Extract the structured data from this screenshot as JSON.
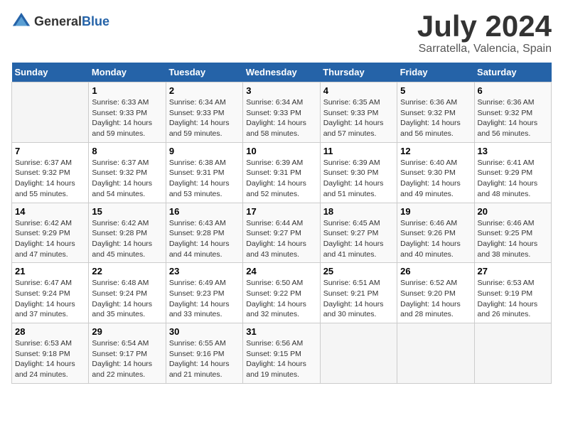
{
  "logo": {
    "general": "General",
    "blue": "Blue"
  },
  "title": "July 2024",
  "subtitle": "Sarratella, Valencia, Spain",
  "days_header": [
    "Sunday",
    "Monday",
    "Tuesday",
    "Wednesday",
    "Thursday",
    "Friday",
    "Saturday"
  ],
  "weeks": [
    [
      {
        "day": "",
        "sunrise": "",
        "sunset": "",
        "daylight": ""
      },
      {
        "day": "1",
        "sunrise": "Sunrise: 6:33 AM",
        "sunset": "Sunset: 9:33 PM",
        "daylight": "Daylight: 14 hours and 59 minutes."
      },
      {
        "day": "2",
        "sunrise": "Sunrise: 6:34 AM",
        "sunset": "Sunset: 9:33 PM",
        "daylight": "Daylight: 14 hours and 59 minutes."
      },
      {
        "day": "3",
        "sunrise": "Sunrise: 6:34 AM",
        "sunset": "Sunset: 9:33 PM",
        "daylight": "Daylight: 14 hours and 58 minutes."
      },
      {
        "day": "4",
        "sunrise": "Sunrise: 6:35 AM",
        "sunset": "Sunset: 9:33 PM",
        "daylight": "Daylight: 14 hours and 57 minutes."
      },
      {
        "day": "5",
        "sunrise": "Sunrise: 6:36 AM",
        "sunset": "Sunset: 9:32 PM",
        "daylight": "Daylight: 14 hours and 56 minutes."
      },
      {
        "day": "6",
        "sunrise": "Sunrise: 6:36 AM",
        "sunset": "Sunset: 9:32 PM",
        "daylight": "Daylight: 14 hours and 56 minutes."
      }
    ],
    [
      {
        "day": "7",
        "sunrise": "Sunrise: 6:37 AM",
        "sunset": "Sunset: 9:32 PM",
        "daylight": "Daylight: 14 hours and 55 minutes."
      },
      {
        "day": "8",
        "sunrise": "Sunrise: 6:37 AM",
        "sunset": "Sunset: 9:32 PM",
        "daylight": "Daylight: 14 hours and 54 minutes."
      },
      {
        "day": "9",
        "sunrise": "Sunrise: 6:38 AM",
        "sunset": "Sunset: 9:31 PM",
        "daylight": "Daylight: 14 hours and 53 minutes."
      },
      {
        "day": "10",
        "sunrise": "Sunrise: 6:39 AM",
        "sunset": "Sunset: 9:31 PM",
        "daylight": "Daylight: 14 hours and 52 minutes."
      },
      {
        "day": "11",
        "sunrise": "Sunrise: 6:39 AM",
        "sunset": "Sunset: 9:30 PM",
        "daylight": "Daylight: 14 hours and 51 minutes."
      },
      {
        "day": "12",
        "sunrise": "Sunrise: 6:40 AM",
        "sunset": "Sunset: 9:30 PM",
        "daylight": "Daylight: 14 hours and 49 minutes."
      },
      {
        "day": "13",
        "sunrise": "Sunrise: 6:41 AM",
        "sunset": "Sunset: 9:29 PM",
        "daylight": "Daylight: 14 hours and 48 minutes."
      }
    ],
    [
      {
        "day": "14",
        "sunrise": "Sunrise: 6:42 AM",
        "sunset": "Sunset: 9:29 PM",
        "daylight": "Daylight: 14 hours and 47 minutes."
      },
      {
        "day": "15",
        "sunrise": "Sunrise: 6:42 AM",
        "sunset": "Sunset: 9:28 PM",
        "daylight": "Daylight: 14 hours and 45 minutes."
      },
      {
        "day": "16",
        "sunrise": "Sunrise: 6:43 AM",
        "sunset": "Sunset: 9:28 PM",
        "daylight": "Daylight: 14 hours and 44 minutes."
      },
      {
        "day": "17",
        "sunrise": "Sunrise: 6:44 AM",
        "sunset": "Sunset: 9:27 PM",
        "daylight": "Daylight: 14 hours and 43 minutes."
      },
      {
        "day": "18",
        "sunrise": "Sunrise: 6:45 AM",
        "sunset": "Sunset: 9:27 PM",
        "daylight": "Daylight: 14 hours and 41 minutes."
      },
      {
        "day": "19",
        "sunrise": "Sunrise: 6:46 AM",
        "sunset": "Sunset: 9:26 PM",
        "daylight": "Daylight: 14 hours and 40 minutes."
      },
      {
        "day": "20",
        "sunrise": "Sunrise: 6:46 AM",
        "sunset": "Sunset: 9:25 PM",
        "daylight": "Daylight: 14 hours and 38 minutes."
      }
    ],
    [
      {
        "day": "21",
        "sunrise": "Sunrise: 6:47 AM",
        "sunset": "Sunset: 9:24 PM",
        "daylight": "Daylight: 14 hours and 37 minutes."
      },
      {
        "day": "22",
        "sunrise": "Sunrise: 6:48 AM",
        "sunset": "Sunset: 9:24 PM",
        "daylight": "Daylight: 14 hours and 35 minutes."
      },
      {
        "day": "23",
        "sunrise": "Sunrise: 6:49 AM",
        "sunset": "Sunset: 9:23 PM",
        "daylight": "Daylight: 14 hours and 33 minutes."
      },
      {
        "day": "24",
        "sunrise": "Sunrise: 6:50 AM",
        "sunset": "Sunset: 9:22 PM",
        "daylight": "Daylight: 14 hours and 32 minutes."
      },
      {
        "day": "25",
        "sunrise": "Sunrise: 6:51 AM",
        "sunset": "Sunset: 9:21 PM",
        "daylight": "Daylight: 14 hours and 30 minutes."
      },
      {
        "day": "26",
        "sunrise": "Sunrise: 6:52 AM",
        "sunset": "Sunset: 9:20 PM",
        "daylight": "Daylight: 14 hours and 28 minutes."
      },
      {
        "day": "27",
        "sunrise": "Sunrise: 6:53 AM",
        "sunset": "Sunset: 9:19 PM",
        "daylight": "Daylight: 14 hours and 26 minutes."
      }
    ],
    [
      {
        "day": "28",
        "sunrise": "Sunrise: 6:53 AM",
        "sunset": "Sunset: 9:18 PM",
        "daylight": "Daylight: 14 hours and 24 minutes."
      },
      {
        "day": "29",
        "sunrise": "Sunrise: 6:54 AM",
        "sunset": "Sunset: 9:17 PM",
        "daylight": "Daylight: 14 hours and 22 minutes."
      },
      {
        "day": "30",
        "sunrise": "Sunrise: 6:55 AM",
        "sunset": "Sunset: 9:16 PM",
        "daylight": "Daylight: 14 hours and 21 minutes."
      },
      {
        "day": "31",
        "sunrise": "Sunrise: 6:56 AM",
        "sunset": "Sunset: 9:15 PM",
        "daylight": "Daylight: 14 hours and 19 minutes."
      },
      {
        "day": "",
        "sunrise": "",
        "sunset": "",
        "daylight": ""
      },
      {
        "day": "",
        "sunrise": "",
        "sunset": "",
        "daylight": ""
      },
      {
        "day": "",
        "sunrise": "",
        "sunset": "",
        "daylight": ""
      }
    ]
  ]
}
